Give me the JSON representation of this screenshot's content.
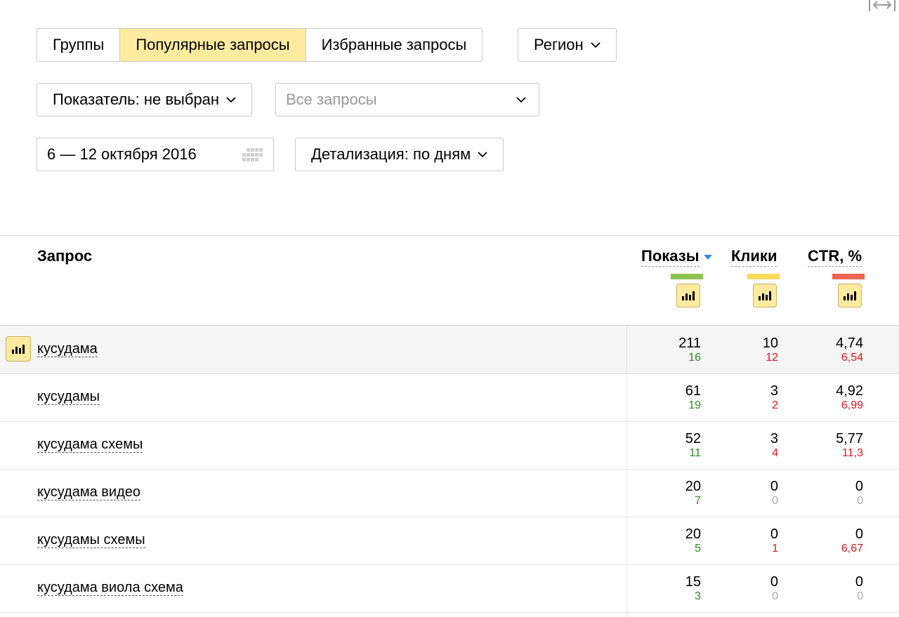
{
  "tabs": [
    {
      "label": "Группы",
      "active": false
    },
    {
      "label": "Популярные запросы",
      "active": true
    },
    {
      "label": "Избранные запросы",
      "active": false
    }
  ],
  "region_label": "Регион",
  "metric_select": "Показатель: не выбран",
  "query_filter": {
    "placeholder": "Все запросы"
  },
  "date_range": "6 — 12 октября 2016",
  "detail_select": "Детализация: по дням",
  "table": {
    "columns": {
      "query": "Запрос",
      "shows": "Показы",
      "clicks": "Клики",
      "ctr": "CTR, %"
    },
    "column_colors": {
      "shows": "#8dc24e",
      "clicks": "#ffd95c",
      "ctr": "#ef6550"
    },
    "sorted_by": "shows",
    "rows": [
      {
        "query": "кусудама",
        "shows": "211",
        "shows_delta": "16",
        "clicks": "10",
        "clicks_delta": "12",
        "ctr": "4,74",
        "ctr_delta": "6,54"
      },
      {
        "query": "кусудамы",
        "shows": "61",
        "shows_delta": "19",
        "clicks": "3",
        "clicks_delta": "2",
        "ctr": "4,92",
        "ctr_delta": "6,99"
      },
      {
        "query": "кусудама схемы",
        "shows": "52",
        "shows_delta": "11",
        "clicks": "3",
        "clicks_delta": "4",
        "ctr": "5,77",
        "ctr_delta": "11,3"
      },
      {
        "query": "кусудама видео",
        "shows": "20",
        "shows_delta": "7",
        "clicks": "0",
        "clicks_delta": "0",
        "ctr": "0",
        "ctr_delta": "0"
      },
      {
        "query": "кусудамы схемы",
        "shows": "20",
        "shows_delta": "5",
        "clicks": "0",
        "clicks_delta": "1",
        "ctr": "0",
        "ctr_delta": "6,67"
      },
      {
        "query": "кусудама виола схема",
        "shows": "15",
        "shows_delta": "3",
        "clicks": "0",
        "clicks_delta": "0",
        "ctr": "0",
        "ctr_delta": "0"
      }
    ]
  }
}
